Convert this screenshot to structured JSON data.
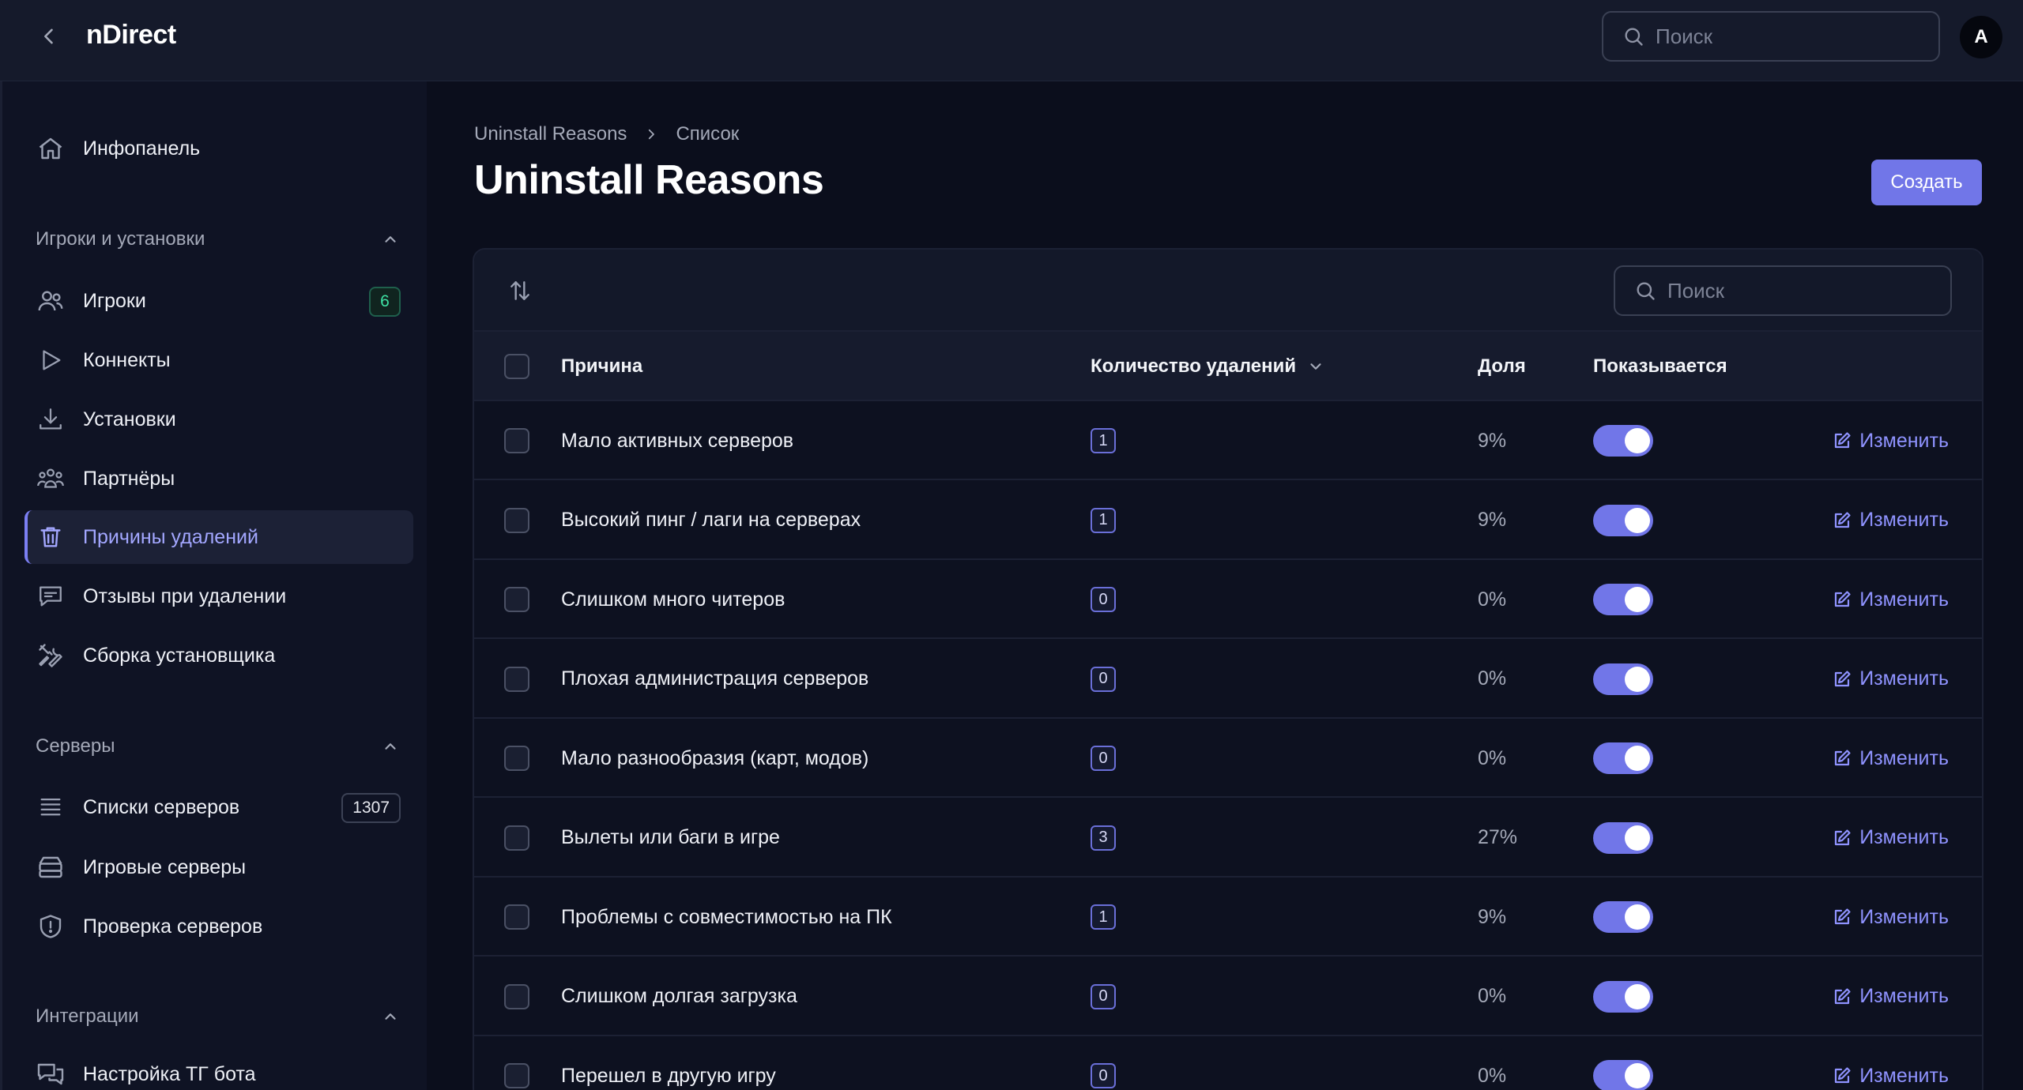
{
  "app": {
    "title": "nDirect"
  },
  "top_search": {
    "placeholder": "Поиск"
  },
  "user": {
    "avatar_letter": "A"
  },
  "sidebar": {
    "dashboard": {
      "label": "Инфопанель",
      "icon": "home-icon"
    },
    "sections": [
      {
        "title": "Игроки и установки",
        "items": [
          {
            "label": "Игроки",
            "icon": "users-icon",
            "badge": "6"
          },
          {
            "label": "Коннекты",
            "icon": "play-icon"
          },
          {
            "label": "Установки",
            "icon": "download-icon"
          },
          {
            "label": "Партнёры",
            "icon": "partners-icon"
          },
          {
            "label": "Причины удалений",
            "icon": "trash-icon",
            "active": true
          },
          {
            "label": "Отзывы при удалении",
            "icon": "chat-icon"
          },
          {
            "label": "Сборка установщика",
            "icon": "tools-icon"
          }
        ]
      },
      {
        "title": "Серверы",
        "items": [
          {
            "label": "Списки серверов",
            "icon": "list-icon",
            "badge": "1307"
          },
          {
            "label": "Игровые серверы",
            "icon": "server-icon"
          },
          {
            "label": "Проверка серверов",
            "icon": "shield-icon"
          }
        ]
      },
      {
        "title": "Интеграции",
        "items": [
          {
            "label": "Настройка ТГ бота",
            "icon": "chat-bubbles-icon"
          }
        ]
      }
    ]
  },
  "breadcrumb": {
    "root": "Uninstall Reasons",
    "current": "Список"
  },
  "page": {
    "title": "Uninstall Reasons",
    "create_label": "Создать"
  },
  "table": {
    "search_placeholder": "Поиск",
    "columns": {
      "reason": "Причина",
      "count": "Количество удалений",
      "share": "Доля",
      "shown": "Показывается"
    },
    "edit_label": "Изменить",
    "rows": [
      {
        "reason": "Мало активных серверов",
        "count": "1",
        "share": "9%",
        "shown": true
      },
      {
        "reason": "Высокий пинг / лаги на серверах",
        "count": "1",
        "share": "9%",
        "shown": true
      },
      {
        "reason": "Слишком много читеров",
        "count": "0",
        "share": "0%",
        "shown": true
      },
      {
        "reason": "Плохая администрация серверов",
        "count": "0",
        "share": "0%",
        "shown": true
      },
      {
        "reason": "Мало разнообразия (карт, модов)",
        "count": "0",
        "share": "0%",
        "shown": true
      },
      {
        "reason": "Вылеты или баги в игре",
        "count": "3",
        "share": "27%",
        "shown": true
      },
      {
        "reason": "Проблемы с совместимостью на ПК",
        "count": "1",
        "share": "9%",
        "shown": true
      },
      {
        "reason": "Слишком долгая загрузка",
        "count": "0",
        "share": "0%",
        "shown": true
      },
      {
        "reason": "Перешел в другую игру",
        "count": "0",
        "share": "0%",
        "shown": true
      }
    ]
  },
  "colors": {
    "accent": "#7176e8",
    "link": "#8f93ff",
    "success": "#3ee0a3",
    "background": "#0b0e1c"
  }
}
